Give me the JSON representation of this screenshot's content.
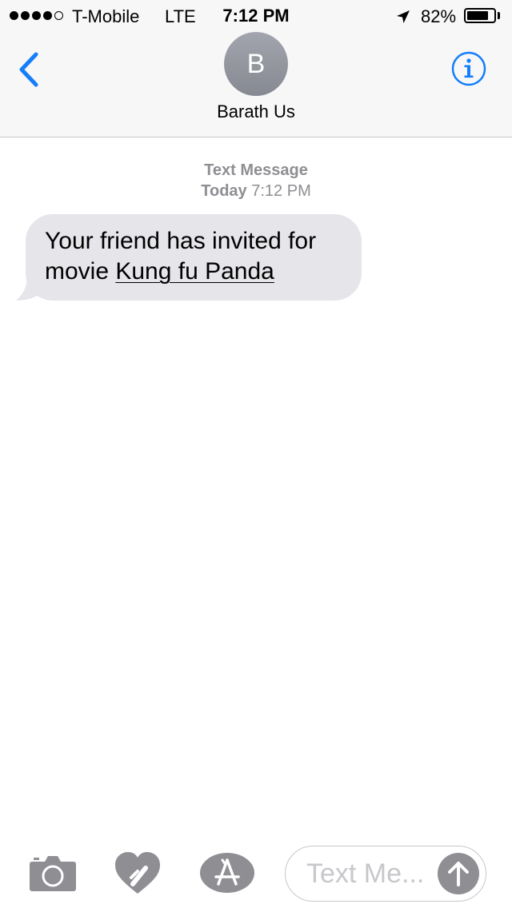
{
  "status_bar": {
    "carrier": "T-Mobile",
    "network": "LTE",
    "time": "7:12 PM",
    "battery_percent": "82%",
    "battery_level": 0.82,
    "signal_bars_filled": 4,
    "signal_bars_total": 5
  },
  "header": {
    "avatar_initial": "B",
    "contact_name": "Barath Us",
    "back_icon": "chevron-left-icon",
    "info_icon": "info-icon",
    "accent_color": "#147efb"
  },
  "conversation": {
    "service_label": "Text Message",
    "date_label": "Today",
    "time_label": "7:12 PM",
    "messages": [
      {
        "direction": "incoming",
        "text_prefix": "Your friend has invited for movie ",
        "link_text": "Kung fu Panda",
        "bubble_color": "#e5e5ea"
      }
    ]
  },
  "toolbar": {
    "camera_icon": "camera-icon",
    "digital_touch_icon": "heart-touch-icon",
    "app_store_icon": "app-store-icon",
    "input_placeholder": "Text Me...",
    "send_icon": "arrow-up-icon"
  }
}
